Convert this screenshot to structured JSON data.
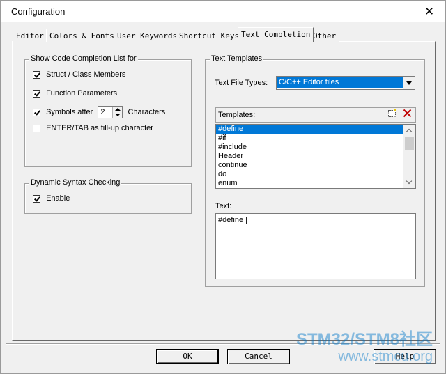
{
  "window": {
    "title": "Configuration",
    "close_symbol": "✕"
  },
  "tabs": [
    {
      "label": "Editor"
    },
    {
      "label": "Colors & Fonts"
    },
    {
      "label": "User Keywords"
    },
    {
      "label": "Shortcut Keys"
    },
    {
      "label": "Text Completion"
    },
    {
      "label": "Other"
    }
  ],
  "active_tab": "Text Completion",
  "completion_group": {
    "title": "Show Code Completion List for",
    "struct_members": {
      "label": "Struct / Class Members",
      "checked": true
    },
    "function_params": {
      "label": "Function Parameters",
      "checked": true
    },
    "symbols_after": {
      "label": "Symbols after",
      "checked": true,
      "value": "2",
      "suffix": "Characters"
    },
    "enter_tab": {
      "label": "ENTER/TAB as fill-up character",
      "checked": false
    }
  },
  "syntax_group": {
    "title": "Dynamic Syntax Checking",
    "enable": {
      "label": "Enable",
      "checked": true
    }
  },
  "templates_group": {
    "title": "Text Templates",
    "file_types_label": "Text File Types:",
    "file_types_value": "C/C++ Editor files",
    "templates_label": "Templates:",
    "items": [
      "#define",
      "#if",
      "#include",
      "Header",
      "continue",
      "do",
      "enum"
    ],
    "selected": "#define",
    "text_label": "Text:",
    "text_value": "#define |"
  },
  "buttons": {
    "ok": "OK",
    "cancel": "Cancel",
    "help": "Help"
  },
  "watermark": {
    "line1": "STM32/STM8社区",
    "line2": "www.stmcu.org"
  },
  "colors": {
    "selection": "#0078d7",
    "dialog_bg": "#f0f0f0",
    "delete_icon": "#c00000"
  }
}
